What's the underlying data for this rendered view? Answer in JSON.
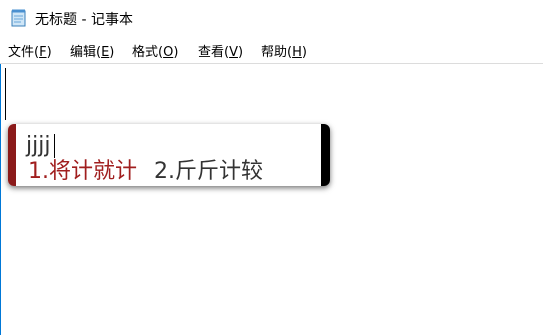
{
  "window": {
    "title": "无标题 - 记事本"
  },
  "menu": {
    "items": [
      {
        "label": "文件(",
        "accel": "F",
        "close": ")"
      },
      {
        "label": "编辑(",
        "accel": "E",
        "close": ")"
      },
      {
        "label": "格式(",
        "accel": "O",
        "close": ")"
      },
      {
        "label": "查看(",
        "accel": "V",
        "close": ")"
      },
      {
        "label": "帮助(",
        "accel": "H",
        "close": ")"
      }
    ]
  },
  "editor": {
    "content": ""
  },
  "ime": {
    "composition": "jjjj",
    "candidates": [
      {
        "num": "1.",
        "text": "将计就计"
      },
      {
        "num": "2.",
        "text": "斤斤计较"
      }
    ],
    "colors": {
      "selected": "#a01e1e",
      "normal": "#333333",
      "left_bar": "#8b1a1a",
      "right_bar": "#000000"
    }
  }
}
